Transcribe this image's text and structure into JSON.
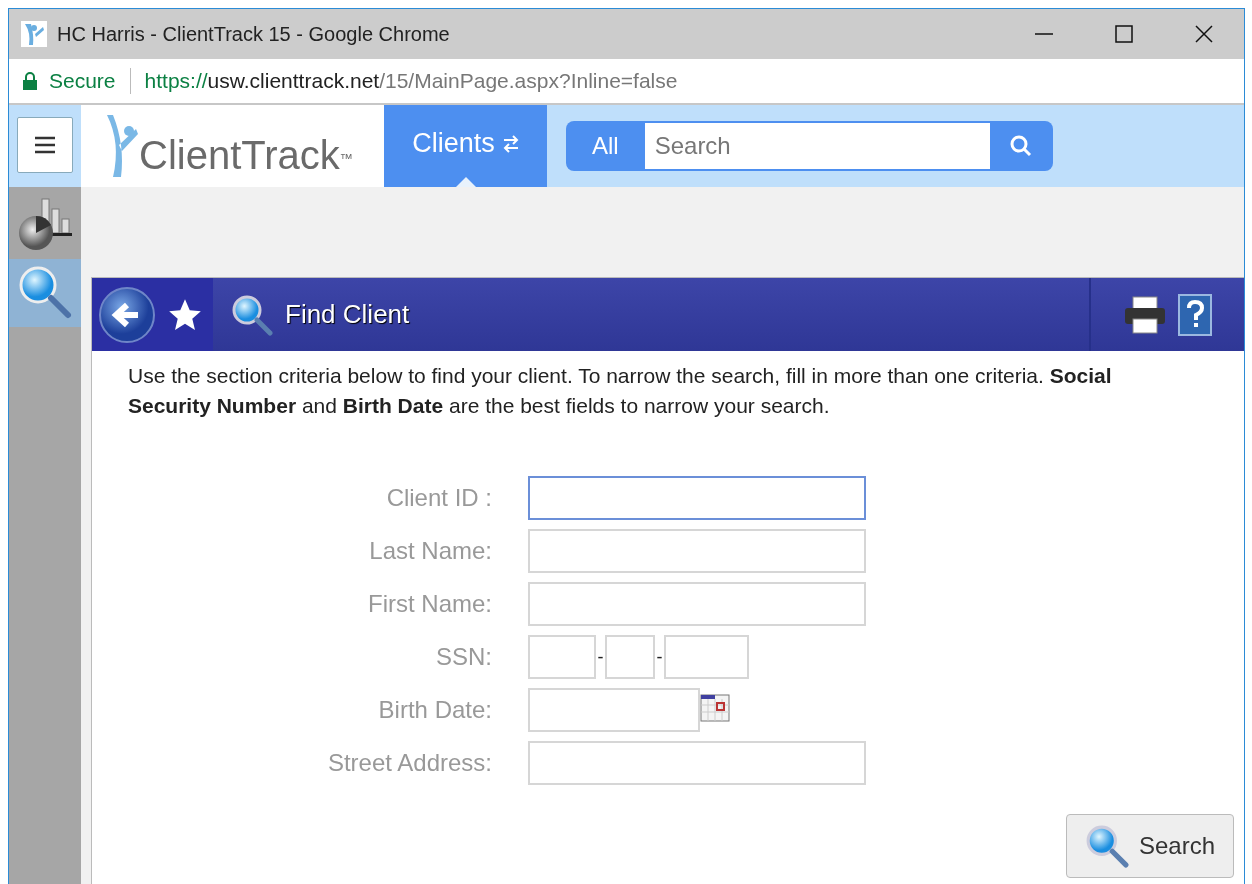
{
  "window": {
    "title": "HC Harris - ClientTrack 15 - Google Chrome"
  },
  "address_bar": {
    "secure_label": "Secure",
    "url_parts": [
      {
        "text": "https://",
        "kind": "scheme"
      },
      {
        "text": "usw.clienttrack.net",
        "kind": "host"
      },
      {
        "text": "/15/MainPage.aspx?Inline=false",
        "kind": "path"
      }
    ]
  },
  "header": {
    "logo": "ClientTrack",
    "trademark": "™",
    "module_tab": {
      "label": "Clients",
      "selected": true
    },
    "search": {
      "scope": "All",
      "placeholder": "Search"
    }
  },
  "sidebar": {
    "items": [
      {
        "kind": "reports",
        "selected": false
      },
      {
        "kind": "search",
        "selected": true
      }
    ]
  },
  "panel": {
    "title": "Find Client",
    "intro": "Use the section criteria below to find your client. To narrow the search, fill in more than one criteria. **Social Security Number** and **Birth Date** are the best fields to narrow your search.",
    "fields": [
      {
        "label": "Client ID :",
        "kind": "text",
        "focused": true
      },
      {
        "label": "Last Name:",
        "kind": "text",
        "focused": false
      },
      {
        "label": "First Name:",
        "kind": "text",
        "focused": false
      },
      {
        "label": "SSN:",
        "kind": "ssn",
        "separator": "-",
        "focused": false
      },
      {
        "label": "Birth Date:",
        "kind": "date",
        "focused": false
      },
      {
        "label": "Street Address:",
        "kind": "text",
        "focused": false
      }
    ],
    "search_button": "Search"
  }
}
